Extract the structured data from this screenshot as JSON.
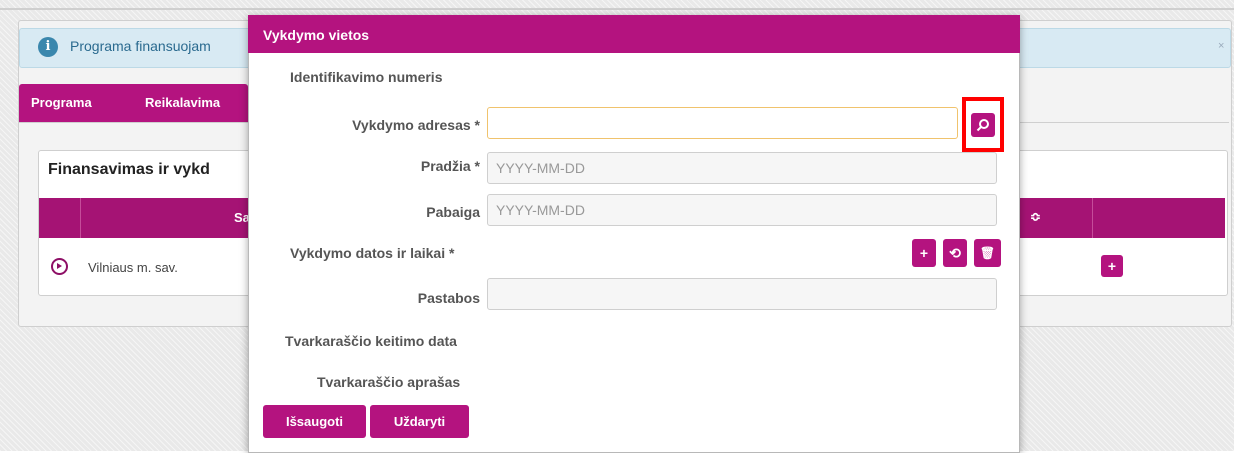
{
  "background": {
    "info_text": "Programa finansuojam",
    "info_close": "×",
    "tabs": [
      "Programa",
      "Reikalavima"
    ],
    "card_title": "Finansavimas ir vykd",
    "table_headers": [
      "Sa",
      "≎"
    ],
    "row_text": "Vilniaus m. sav.",
    "row_add": "+"
  },
  "modal": {
    "title": "Vykdymo vietos",
    "fields": {
      "id_label": "Identifikavimo numeris",
      "address_label": "Vykdymo adresas *",
      "address_value": "",
      "start_label": "Pradžia *",
      "start_placeholder": "YYYY-MM-DD",
      "end_label": "Pabaiga",
      "end_placeholder": "YYYY-MM-DD",
      "datetimes_label": "Vykdymo datos ir laikai *",
      "notes_label": "Pastabos",
      "notes_value": "",
      "schedule_change_label": "Tvarkaraščio keitimo data",
      "schedule_desc_label": "Tvarkaraščio aprašas"
    },
    "action_icons": [
      "+",
      "⟲",
      "🗑"
    ],
    "buttons": {
      "save": "Išsaugoti",
      "close": "Uždaryti"
    }
  },
  "colors": {
    "accent": "#b4137f",
    "highlight": "#ff0000",
    "info_bg": "#d8eaf3"
  },
  "icons": {
    "search": "search-icon",
    "info": "info-icon",
    "add": "plus-icon",
    "refresh": "refresh-icon",
    "delete": "trash-icon"
  }
}
